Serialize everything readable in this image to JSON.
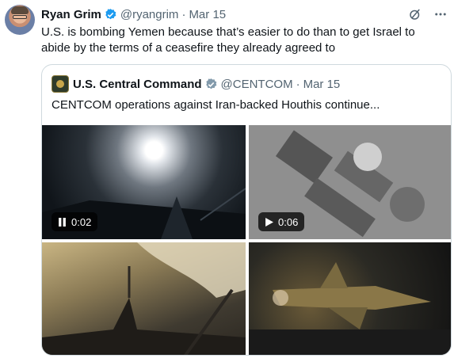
{
  "tweet": {
    "author_name": "Ryan Grim",
    "author_handle": "@ryangrim",
    "separator": "·",
    "date": "Mar 15",
    "text": "U.S. is bombing Yemen because that’s easier to do than to get Israel to abide by the terms of a ceasefire they already agreed to",
    "icons": [
      "verified-badge-icon",
      "grok-icon",
      "more-icon"
    ]
  },
  "quote": {
    "author_name": "U.S. Central Command",
    "author_handle": "@CENTCOM",
    "separator": "·",
    "date": "Mar 15",
    "text": "CENTCOM operations against Iran-backed Houthis continue...",
    "media": [
      {
        "kind": "video",
        "duration": "0:02",
        "state": "pause-icon"
      },
      {
        "kind": "video",
        "duration": "0:06",
        "state": "play-icon"
      },
      {
        "kind": "image"
      },
      {
        "kind": "image"
      }
    ]
  },
  "colors": {
    "text_primary": "#0f1419",
    "text_secondary": "#536471",
    "verified_blue": "#1d9bf0",
    "border": "#cfd9de"
  }
}
